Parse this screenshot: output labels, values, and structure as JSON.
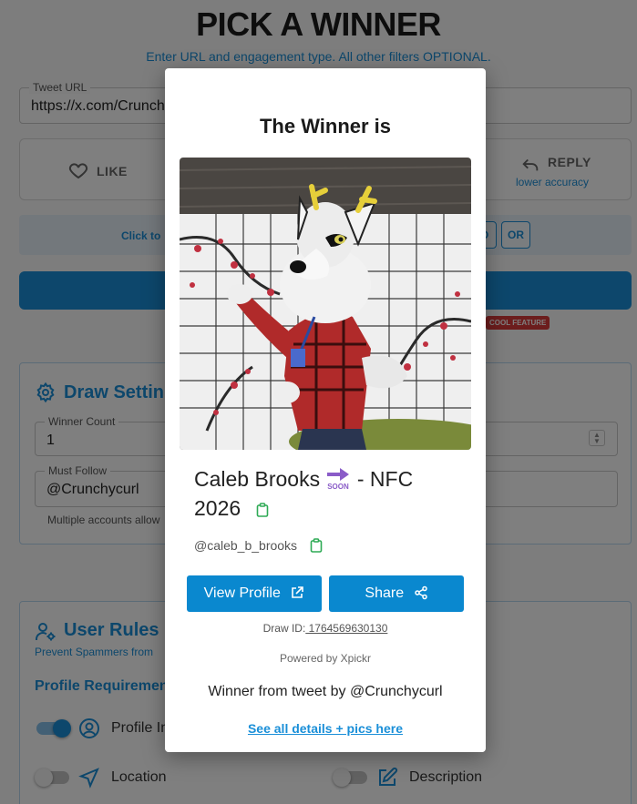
{
  "page": {
    "title": "PICK A WINNER",
    "subtitle": "Enter URL and engagement type. All other filters OPTIONAL."
  },
  "tweet_url": {
    "label": "Tweet URL",
    "value": "https://x.com/Crunch"
  },
  "engagement": {
    "like_label": "LIKE",
    "reply_label": "REPLY",
    "reply_note": "lower accuracy"
  },
  "filter_bar": {
    "click_text": "Click to",
    "and_label": "D",
    "or_label": "OR"
  },
  "cool_badge": "COOL FEATURE",
  "draw_settings": {
    "title": "Draw Settin",
    "winner_count_label": "Winner Count",
    "winner_count_value": "1",
    "must_follow_label": "Must Follow",
    "must_follow_value": "@Crunchycurl",
    "hint": "Multiple accounts allow"
  },
  "user_rules": {
    "title": "User Rules",
    "subtitle": "Prevent Spammers from",
    "profile_requirements": "Profile Requiremen",
    "toggles": [
      {
        "label": "Profile In",
        "on": true,
        "icon": "user-circle-icon"
      },
      {
        "label": "Location",
        "on": false,
        "icon": "location-arrow-icon"
      },
      {
        "label": "Description",
        "on": false,
        "icon": "edit-icon"
      }
    ]
  },
  "modal": {
    "title": "The Winner is",
    "winner_name_part1": "Caleb Brooks",
    "winner_name_part2": "- NFC",
    "winner_name_part3": "2026",
    "soon_icon_text": "SOON",
    "handle": "@caleb_b_brooks",
    "view_profile_label": "View Profile",
    "share_label": "Share",
    "draw_id_label": "Draw ID:",
    "draw_id_value": " 1764569630130",
    "powered_by": "Powered by Xpickr",
    "from_tweet": "Winner from tweet by @Crunchycurl",
    "details_link": "See all details + pics here"
  },
  "colors": {
    "accent": "#1a8fd8",
    "button": "#0a88cf",
    "badge": "#d83a3a",
    "copy_icon": "#2eaa55",
    "soon_icon": "#8a5cc8"
  }
}
